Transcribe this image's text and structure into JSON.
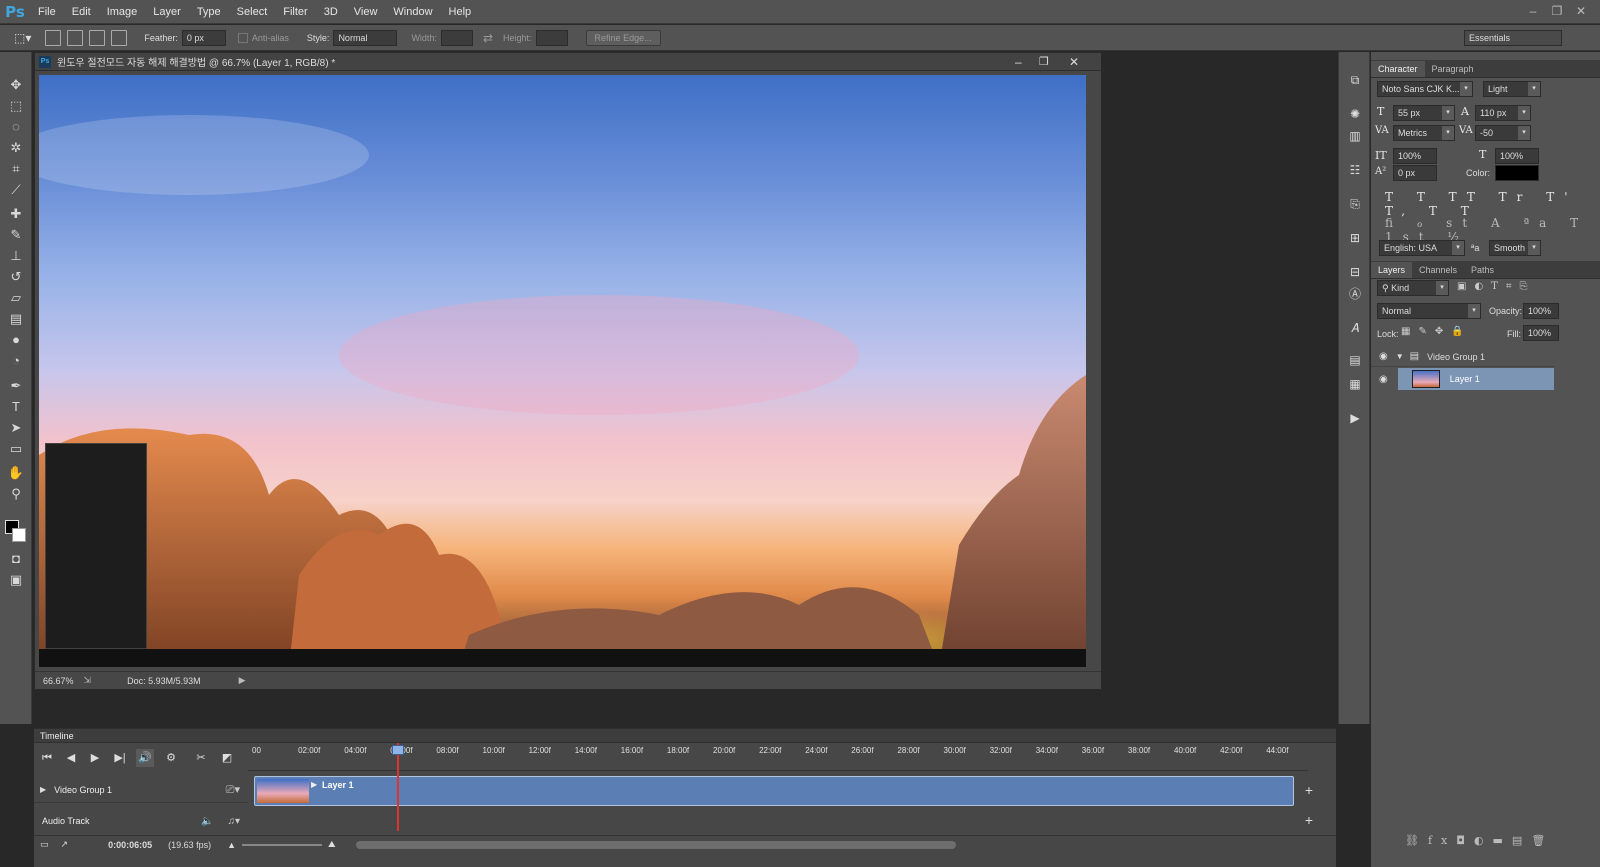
{
  "app": {
    "logo": "Ps"
  },
  "menu": [
    "File",
    "Edit",
    "Image",
    "Layer",
    "Type",
    "Select",
    "Filter",
    "3D",
    "View",
    "Window",
    "Help"
  ],
  "window_controls": {
    "minimize": "–",
    "restore": "❐",
    "close": "✕"
  },
  "options_bar": {
    "feather_label": "Feather:",
    "feather_value": "0 px",
    "antialias_label": "Anti-alias",
    "style_label": "Style:",
    "style_value": "Normal",
    "width_label": "Width:",
    "height_label": "Height:",
    "refine_edge": "Refine Edge...",
    "workspace": "Essentials"
  },
  "document": {
    "title": "윈도우 절전모드 자동 해제 해결방법 @ 66.7% (Layer 1, RGB/8) *",
    "zoom": "66.67%",
    "doc_size": "Doc: 5.93M/5.93M"
  },
  "character_panel": {
    "tabs": [
      "Character",
      "Paragraph"
    ],
    "font_family": "Noto Sans CJK K...",
    "font_style": "Light",
    "size": "55 px",
    "leading": "110 px",
    "kerning": "Metrics",
    "tracking": "-50",
    "vscale": "100%",
    "hscale": "100%",
    "baseline": "0 px",
    "color_label": "Color:",
    "color_value": "#000000",
    "language": "English: USA",
    "aa_label": "ªa",
    "antialias": "Smooth"
  },
  "layers_panel": {
    "tabs": [
      "Layers",
      "Channels",
      "Paths"
    ],
    "filter": "Kind",
    "blend_mode": "Normal",
    "opacity_label": "Opacity:",
    "opacity": "100%",
    "lock_label": "Lock:",
    "fill_label": "Fill:",
    "fill": "100%",
    "layers": [
      {
        "name": "Video Group 1",
        "type": "group"
      },
      {
        "name": "Layer 1",
        "type": "layer",
        "selected": true
      }
    ]
  },
  "timeline": {
    "title": "Timeline",
    "ticks": [
      "00",
      "02:00f",
      "04:00f",
      "06:00f",
      "08:00f",
      "10:00f",
      "12:00f",
      "14:00f",
      "16:00f",
      "18:00f",
      "20:00f",
      "22:00f",
      "24:00f",
      "26:00f",
      "28:00f",
      "30:00f",
      "32:00f",
      "34:00f",
      "36:00f",
      "38:00f",
      "40:00f",
      "42:00f",
      "44:00f"
    ],
    "tracks": [
      {
        "name": "Video Group 1"
      },
      {
        "name": "Audio Track"
      }
    ],
    "clip_label": "Layer 1",
    "current_time": "0:00:06:05",
    "fps": "(19.63 fps)",
    "playhead_time": "06:05f"
  },
  "icons": {
    "move": "move-icon",
    "marquee": "marquee-icon",
    "lasso": "lasso-icon",
    "magic_wand": "magic-wand-icon",
    "crop": "crop-icon",
    "eyedropper": "eyedropper-icon",
    "healing": "healing-brush-icon",
    "brush": "brush-icon",
    "stamp": "clone-stamp-icon",
    "history_brush": "history-brush-icon",
    "eraser": "eraser-icon",
    "gradient": "gradient-icon",
    "blur": "blur-icon",
    "dodge": "dodge-icon",
    "pen": "pen-icon",
    "type": "type-icon",
    "path_select": "path-select-icon",
    "shape": "shape-icon",
    "hand": "hand-icon",
    "zoom": "zoom-icon"
  },
  "colors": {
    "accent": "#3fa7e0",
    "panel": "#535353",
    "timeline_clip": "#5b7fb5",
    "playhead": "#d9362f"
  }
}
